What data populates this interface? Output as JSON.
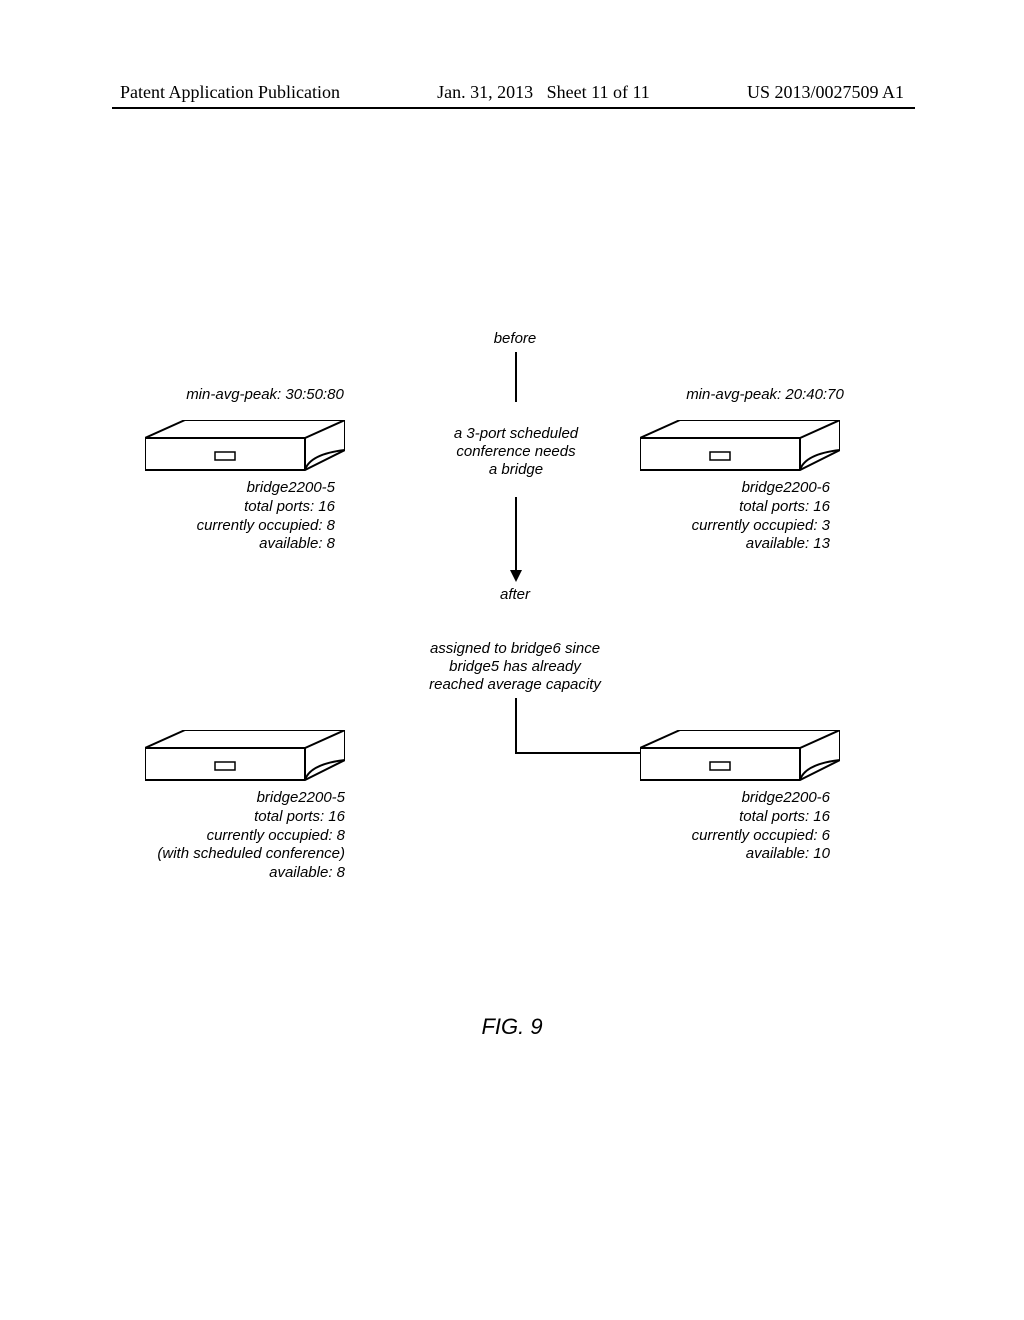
{
  "header": {
    "left": "Patent Application Publication",
    "date": "Jan. 31, 2013",
    "sheet": "Sheet 11 of 11",
    "docnum": "US 2013/0027509 A1"
  },
  "figure_caption": "FIG. 9",
  "timeline": {
    "before": "before",
    "after": "after",
    "center_note": "a 3-port scheduled\nconference needs\na bridge",
    "assign_note": "assigned to bridge6 since\nbridge5 has already\nreached average capacity"
  },
  "bridges": {
    "before": {
      "left": {
        "min_avg_peak": "min-avg-peak: 30:50:80",
        "name": "bridge2200-5",
        "total": "total ports: 16",
        "occupied": "currently occupied: 8",
        "available": "available: 8"
      },
      "right": {
        "min_avg_peak": "min-avg-peak: 20:40:70",
        "name": "bridge2200-6",
        "total": "total ports: 16",
        "occupied": "currently occupied: 3",
        "available": "available: 13"
      }
    },
    "after": {
      "left": {
        "name": "bridge2200-5",
        "total": "total ports: 16",
        "occupied": "currently occupied: 8",
        "note": "(with scheduled conference)",
        "available": "available: 8"
      },
      "right": {
        "name": "bridge2200-6",
        "total": "total ports: 16",
        "occupied": "currently occupied: 6",
        "available": "available: 10"
      }
    }
  }
}
